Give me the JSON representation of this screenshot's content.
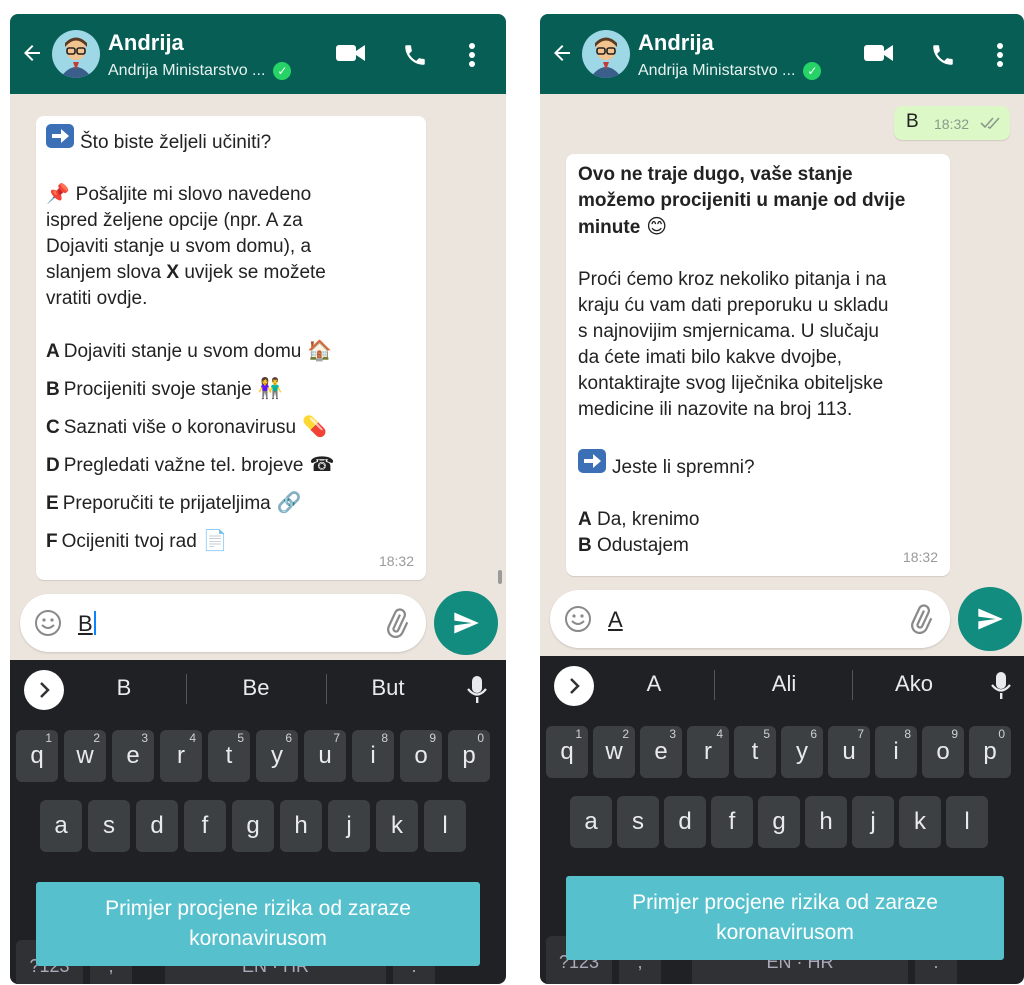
{
  "left": {
    "header": {
      "name": "Andrija",
      "subtitle": "Andrija Ministarstvo ..."
    },
    "message": {
      "intro": "Što biste željeli učiniti?",
      "instruction_lines": [
        "Pošaljite mi slovo navedeno",
        "ispred željene opcije (npr. A za",
        "Dojaviti stanje u svom domu), a"
      ],
      "instruction_x_pre": "slanjem slova ",
      "instruction_x_letter": "X",
      "instruction_x_post": " uvijek se možete",
      "instruction_last": "vratiti ovdje.",
      "options": [
        {
          "key": "A",
          "label": "Dojaviti stanje u svom domu",
          "icon": "house-icon",
          "glyph": "🏠"
        },
        {
          "key": "B",
          "label": "Procijeniti svoje stanje",
          "icon": "people-icon",
          "glyph": "👫"
        },
        {
          "key": "C",
          "label": "Saznati više o koronavirusu",
          "icon": "pill-icon",
          "glyph": "💊"
        },
        {
          "key": "D",
          "label": "Pregledati važne tel. brojeve",
          "icon": "telephone-icon",
          "glyph": "☎"
        },
        {
          "key": "E",
          "label": "Preporučiti te prijateljima",
          "icon": "link-icon",
          "glyph": "🔗"
        },
        {
          "key": "F",
          "label": "Ocijeniti tvoj rad",
          "icon": "page-icon",
          "glyph": "📄"
        }
      ],
      "time": "18:32"
    },
    "input": {
      "value": "B"
    },
    "suggestions": [
      "B",
      "Be",
      "But"
    ],
    "caption_line1": "Primjer procjene rizika od zaraze",
    "caption_line2": "koronavirusom"
  },
  "right": {
    "header": {
      "name": "Andrija",
      "subtitle": "Andrija Ministarstvo ..."
    },
    "sent": {
      "text": "B",
      "time": "18:32"
    },
    "message": {
      "bold_lines": [
        "Ovo ne traje dugo, vaše stanje",
        "možemo procijeniti u manje od dvije",
        "minute"
      ],
      "body_lines": [
        "Proći ćemo kroz nekoliko pitanja i na",
        "kraju ću vam dati preporuku u skladu",
        "s najnovijim smjernicama. U slučaju",
        "da ćete imati bilo kakve dvojbe,",
        "kontaktirajte svog liječnika obiteljske",
        "medicine ili nazovite na broj 113."
      ],
      "question": "Jeste li spremni?",
      "options": [
        {
          "key": "A",
          "label": "Da, krenimo"
        },
        {
          "key": "B",
          "label": "Odustajem"
        }
      ],
      "time": "18:32"
    },
    "input": {
      "value": "A"
    },
    "suggestions": [
      "A",
      "Ali",
      "Ako"
    ],
    "caption_line1": "Primjer procjene rizika od zaraze",
    "caption_line2": "koronavirusom"
  },
  "keyboard": {
    "row1": [
      {
        "k": "q",
        "n": "1"
      },
      {
        "k": "w",
        "n": "2"
      },
      {
        "k": "e",
        "n": "3"
      },
      {
        "k": "r",
        "n": "4"
      },
      {
        "k": "t",
        "n": "5"
      },
      {
        "k": "y",
        "n": "6"
      },
      {
        "k": "u",
        "n": "7"
      },
      {
        "k": "i",
        "n": "8"
      },
      {
        "k": "o",
        "n": "9"
      },
      {
        "k": "p",
        "n": "0"
      }
    ],
    "row2": [
      "a",
      "s",
      "d",
      "f",
      "g",
      "h",
      "j",
      "k",
      "l"
    ],
    "symbols_key": "?123",
    "comma_key": ",",
    "space_key": "EN · HR",
    "period_key": "."
  },
  "colors": {
    "header": "#075e54",
    "send": "#128c7e",
    "caption": "#56c1cd",
    "outgoing": "#dcf8c6",
    "keyboard": "#202124"
  }
}
